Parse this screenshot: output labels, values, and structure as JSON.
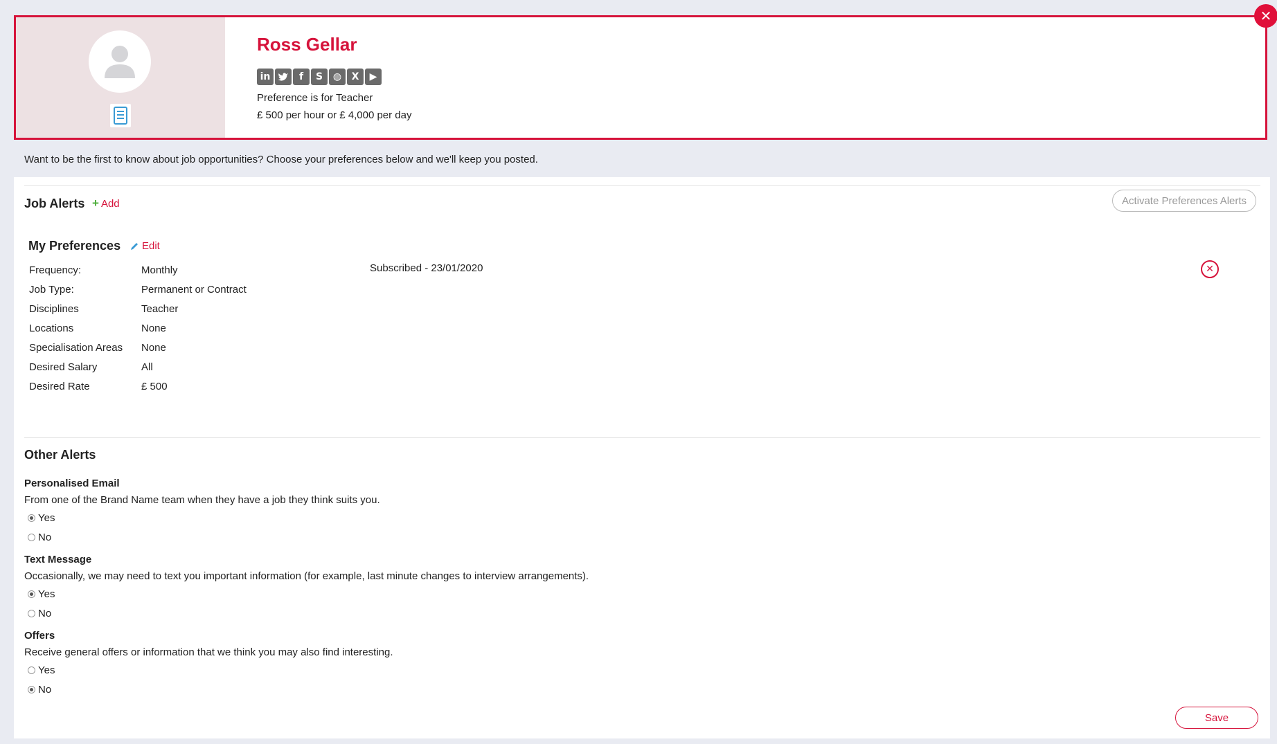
{
  "profile": {
    "name": "Ross Gellar",
    "preference": "Preference is for Teacher",
    "rate": "£ 500 per hour or £ 4,000 per day",
    "socials": [
      {
        "icon": "linkedin-icon",
        "glyph": "in"
      },
      {
        "icon": "twitter-icon",
        "glyph": "🐦"
      },
      {
        "icon": "facebook-icon",
        "glyph": "f"
      },
      {
        "icon": "skype-icon",
        "glyph": "S"
      },
      {
        "icon": "globe-icon",
        "glyph": "◍"
      },
      {
        "icon": "xing-icon",
        "glyph": "X"
      },
      {
        "icon": "youtube-icon",
        "glyph": "▶"
      }
    ]
  },
  "intro": "Want to be the first to know about job opportunities? Choose your preferences below and we'll keep you posted.",
  "job_alerts": {
    "title": "Job Alerts",
    "add_label": "Add",
    "activate_label": "Activate Preferences Alerts"
  },
  "preferences": {
    "title": "My Preferences",
    "edit_label": "Edit",
    "subscribed": "Subscribed - 23/01/2020",
    "rows": [
      {
        "label": "Frequency:",
        "value": "Monthly"
      },
      {
        "label": "Job Type:",
        "value": "Permanent or Contract"
      },
      {
        "label": "Disciplines",
        "value": "Teacher"
      },
      {
        "label": "Locations",
        "value": "None"
      },
      {
        "label": "Specialisation Areas",
        "value": "None"
      },
      {
        "label": "Desired Salary",
        "value": "All"
      },
      {
        "label": "Desired Rate",
        "value": "£ 500"
      }
    ]
  },
  "other_alerts": {
    "title": "Other Alerts",
    "yes_label": "Yes",
    "no_label": "No",
    "groups": [
      {
        "title": "Personalised Email",
        "desc": "From one of the Brand Name team when they have a job they think suits you.",
        "selected": "yes"
      },
      {
        "title": "Text Message",
        "desc": "Occasionally, we may need to text you important information (for example, last minute changes to interview arrangements).",
        "selected": "yes"
      },
      {
        "title": "Offers",
        "desc": "Receive general offers or information that we think you may also find interesting.",
        "selected": "no"
      }
    ]
  },
  "save_label": "Save",
  "colors": {
    "accent": "#d6133b",
    "add_plus": "#4cae3a",
    "doc_icon": "#3a9bd5"
  }
}
